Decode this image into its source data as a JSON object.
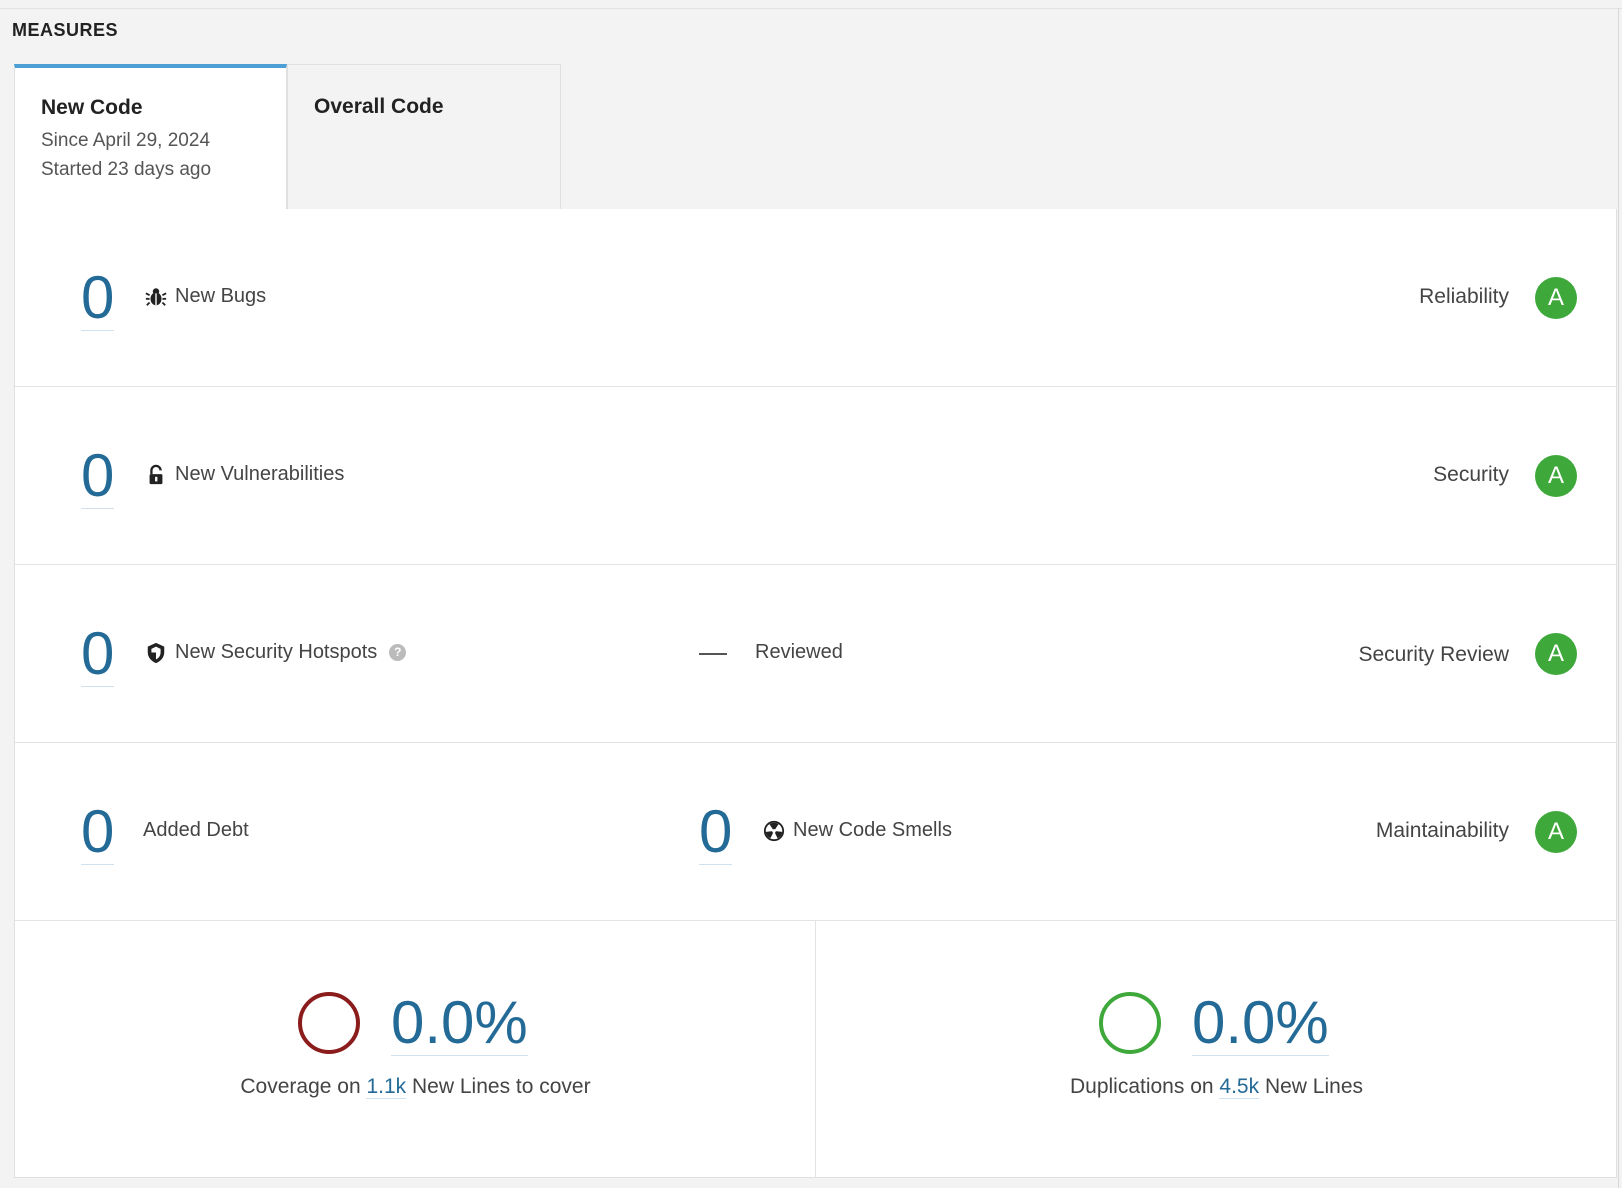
{
  "section_title": "MEASURES",
  "tabs": {
    "new_code": {
      "label": "New Code",
      "since": "Since April 29, 2024",
      "started": "Started 23 days ago"
    },
    "overall_code": {
      "label": "Overall Code"
    }
  },
  "reliability": {
    "value": "0",
    "label": "New Bugs",
    "icon": "bug-icon",
    "rating_name": "Reliability",
    "rating": "A"
  },
  "security": {
    "value": "0",
    "label": "New Vulnerabilities",
    "icon": "lock-open-icon",
    "rating_name": "Security",
    "rating": "A"
  },
  "security_review": {
    "value": "0",
    "label": "New Security Hotspots",
    "icon": "shield-icon",
    "reviewed_value": "—",
    "reviewed_label": "Reviewed",
    "rating_name": "Security Review",
    "rating": "A"
  },
  "maintainability": {
    "debt_value": "0",
    "debt_label": "Added Debt",
    "smells_value": "0",
    "smells_label": "New Code Smells",
    "icon": "code-smell-icon",
    "rating_name": "Maintainability",
    "rating": "A"
  },
  "coverage": {
    "value": "0.0%",
    "caption_prefix": "Coverage on",
    "lines": "1.1k",
    "caption_suffix": "New Lines to cover",
    "ring_color": "#8b1c1c"
  },
  "duplications": {
    "value": "0.0%",
    "caption_prefix": "Duplications on",
    "lines": "4.5k",
    "caption_suffix": "New Lines",
    "ring_color": "#3ea83a"
  },
  "colors": {
    "accent": "#4b9fd5",
    "link": "#236a97",
    "rating_a": "#3ea83a"
  }
}
